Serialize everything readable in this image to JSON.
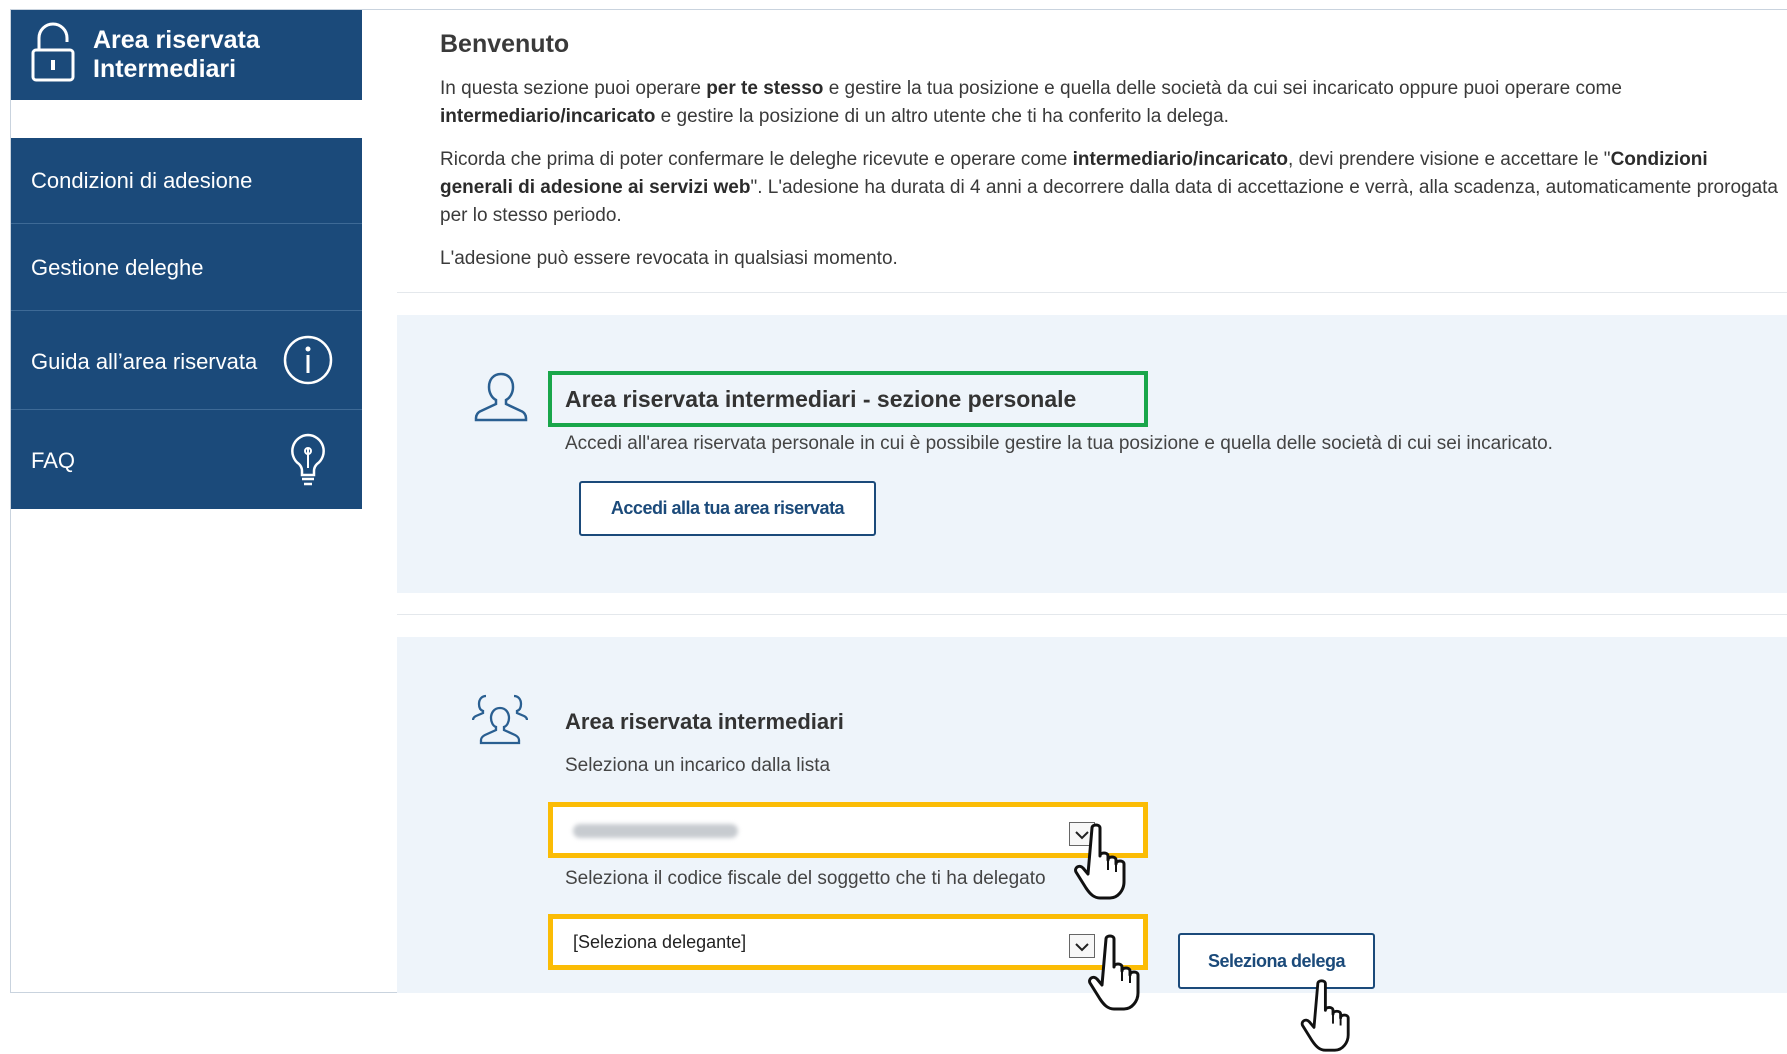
{
  "sidebar": {
    "title_line1": "Area riservata",
    "title_line2": "Intermediari",
    "items": [
      {
        "label": "Condizioni di adesione"
      },
      {
        "label": "Gestione deleghe"
      },
      {
        "label": "Guida all’area riservata"
      },
      {
        "label": "FAQ"
      }
    ]
  },
  "welcome": {
    "title": "Benvenuto",
    "p1_a": "In questa sezione puoi operare ",
    "p1_b": "per te stesso",
    "p1_c": " e gestire la tua posizione e quella delle società da cui sei incaricato oppure puoi operare come ",
    "p1_d": "intermediario/incaricato",
    "p1_e": " e gestire la posizione di un altro utente che ti ha conferito la delega.",
    "p2_a": "Ricorda che prima di poter confermare le deleghe ricevute e operare come ",
    "p2_b": "intermediario/incaricato",
    "p2_c": ", devi prendere visione e accettare le \"",
    "p2_d": "Condizioni generali di adesione ai servizi web",
    "p2_e": "\". L'adesione ha durata di 4 anni a decorrere dalla data di accettazione e verrà, alla scadenza, automaticamente prorogata per lo stesso periodo.",
    "p3": "L'adesione può essere revocata in qualsiasi momento."
  },
  "personal": {
    "title": "Area riservata intermediari - sezione personale",
    "text": "Accedi all'area riservata personale in cui è possibile gestire la tua posizione e quella delle società di cui sei incaricato.",
    "button": "Accedi alla tua area riservata"
  },
  "intermediari": {
    "title": "Area riservata intermediari",
    "select1_label": "Seleziona un incarico dalla lista",
    "select2_label": "Seleziona il codice fiscale del soggetto che ti ha delegato",
    "select2_value": "[Seleziona delegante]",
    "button": "Seleziona delega"
  },
  "colors": {
    "sidebar_bg": "#1b4a7a",
    "panel_bg": "#eef4fa",
    "highlight_green": "#19a64a",
    "highlight_yellow": "#fbbc05"
  },
  "icons": [
    "lock-icon",
    "info-icon",
    "lightbulb-icon",
    "user-icon",
    "users-icon",
    "chevron-down-icon",
    "pointer-hand-icon"
  ]
}
